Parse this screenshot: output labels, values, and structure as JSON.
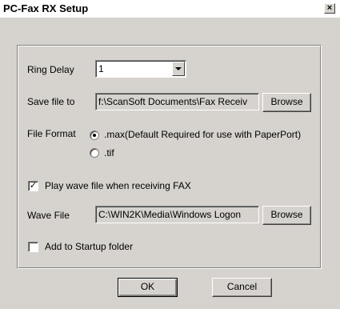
{
  "window": {
    "title": "PC-Fax RX Setup",
    "close_glyph": "×"
  },
  "ring_delay": {
    "label": "Ring Delay",
    "value": "1"
  },
  "save_file": {
    "label": "Save file to",
    "value": "f:\\ScanSoft Documents\\Fax Receiv",
    "browse_label": "Browse"
  },
  "file_format": {
    "label": "File Format",
    "options": [
      {
        "label": ".max(Default Required for use with PaperPort)",
        "selected": true
      },
      {
        "label": ".tif",
        "selected": false
      }
    ]
  },
  "play_wave": {
    "label": "Play wave file when receiving FAX",
    "checked": true,
    "check_glyph": "✓"
  },
  "wave_file": {
    "label": "Wave File",
    "value": "C:\\WIN2K\\Media\\Windows Logon",
    "browse_label": "Browse"
  },
  "startup": {
    "label": "Add to Startup folder",
    "checked": false
  },
  "buttons": {
    "ok": "OK",
    "cancel": "Cancel"
  }
}
